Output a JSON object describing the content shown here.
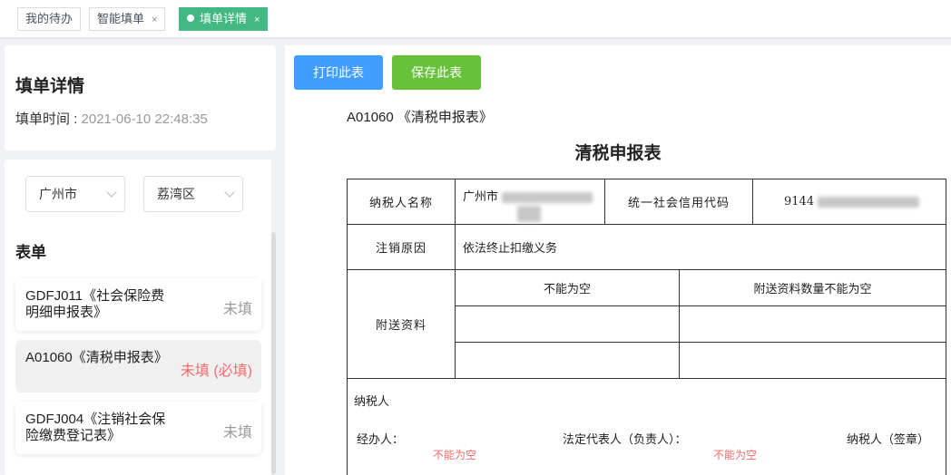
{
  "tabs": [
    {
      "label": "我的待办",
      "closable": false,
      "active": false
    },
    {
      "label": "智能填单",
      "closable": true,
      "active": false
    },
    {
      "label": "填单详情",
      "closable": true,
      "active": true
    }
  ],
  "close_glyph": "×",
  "info": {
    "title": "填单详情",
    "time_label": "填单时间 : ",
    "time_value": "2021-06-10 22:48:35"
  },
  "filters": {
    "city": "广州市",
    "district": "荔湾区"
  },
  "list": {
    "title": "表单",
    "items": [
      {
        "name": "GDFJ011《社会保险费明细申报表》",
        "status": "未填",
        "required": false
      },
      {
        "name": "A01060《清税申报表》",
        "status": "未填 (必填)",
        "required": true
      },
      {
        "name": "GDFJ004《注销社会保险缴费登记表》",
        "status": "未填",
        "required": false
      }
    ]
  },
  "toolbar": {
    "print_label": "打印此表",
    "save_label": "保存此表"
  },
  "doc": {
    "code": "A01060 《清税申报表》",
    "title": "清税申报表",
    "taxpayer_name_label": "纳税人名称",
    "taxpayer_name_value": "广州市",
    "credit_code_label": "统一社会信用代码",
    "credit_code_value": "9144",
    "cancel_reason_label": "注销原因",
    "cancel_reason_value": "依法终止扣缴义务",
    "attachments_label": "附送资料",
    "attachment_error_1": "不能为空",
    "attachment_error_2": "附送资料数量不能为空",
    "taxpayer_label": "纳税人",
    "handler_label": "经办人：",
    "legal_rep_label": "法定代表人（负责人）：",
    "seal_label": "纳税人（签章）",
    "handler_error": "不能为空",
    "legal_rep_error": "不能为空"
  },
  "colors": {
    "accent_green": "#42b983",
    "primary_blue": "#409eff",
    "success_green": "#67c23a",
    "danger": "#f56c6c"
  }
}
